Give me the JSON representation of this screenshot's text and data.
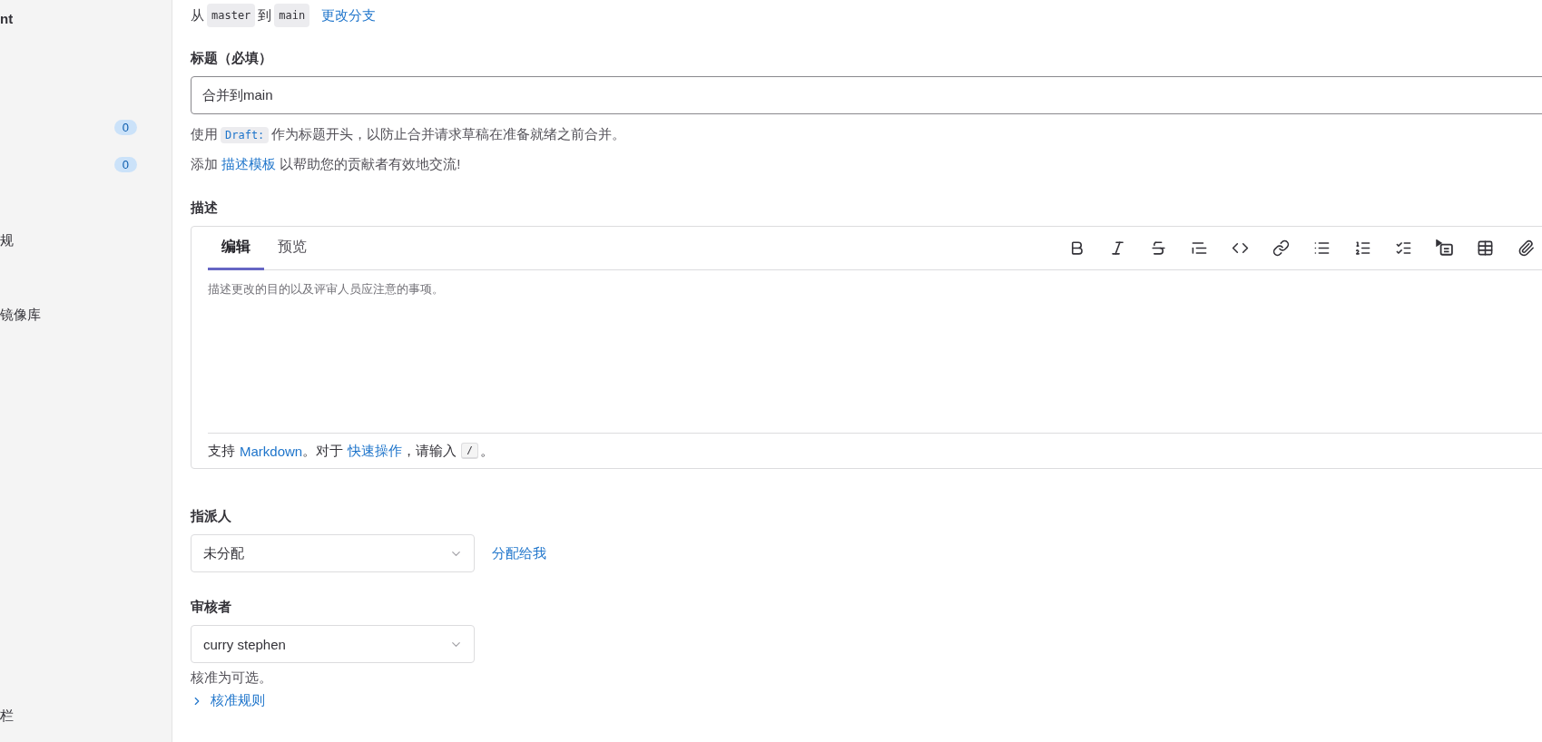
{
  "sidebar": {
    "items": [
      {
        "kind": "heading",
        "label": "nt"
      },
      {
        "kind": "badge",
        "count": "0"
      },
      {
        "kind": "badge",
        "count": "0"
      },
      {
        "kind": "text",
        "label": "规"
      },
      {
        "kind": "text",
        "label": "镜像库"
      },
      {
        "kind": "text",
        "label": "栏"
      }
    ]
  },
  "branch_line": {
    "prefix": "从",
    "source": "master",
    "middle": "到",
    "target": "main",
    "change_link": "更改分支"
  },
  "title_field": {
    "label": "标题（必填）",
    "value": "合并到main"
  },
  "draft_hint": {
    "before": "使用",
    "code": "Draft:",
    "after": "作为标题开头，以防止合并请求草稿在准备就绪之前合并。"
  },
  "template_hint": {
    "before": "添加",
    "link": "描述模板",
    "after": "以帮助您的贡献者有效地交流!"
  },
  "description": {
    "label": "描述",
    "tabs": [
      {
        "label": "编辑",
        "selected": true
      },
      {
        "label": "预览",
        "selected": false
      }
    ],
    "placeholder": "描述更改的目的以及评审人员应注意的事项。",
    "footer": {
      "before": "支持",
      "link": "Markdown",
      "middle": "。对于",
      "quick_link": "快速操作",
      "after": "，请输入",
      "key": "/",
      "end": "。"
    }
  },
  "assignee": {
    "label": "指派人",
    "value": "未分配",
    "assign_link": "分配给我"
  },
  "reviewer": {
    "label": "审核者",
    "value": "curry stephen",
    "note": "核准为可选。",
    "rules_toggle": {
      "label": "核准规则",
      "expanded": false
    }
  }
}
